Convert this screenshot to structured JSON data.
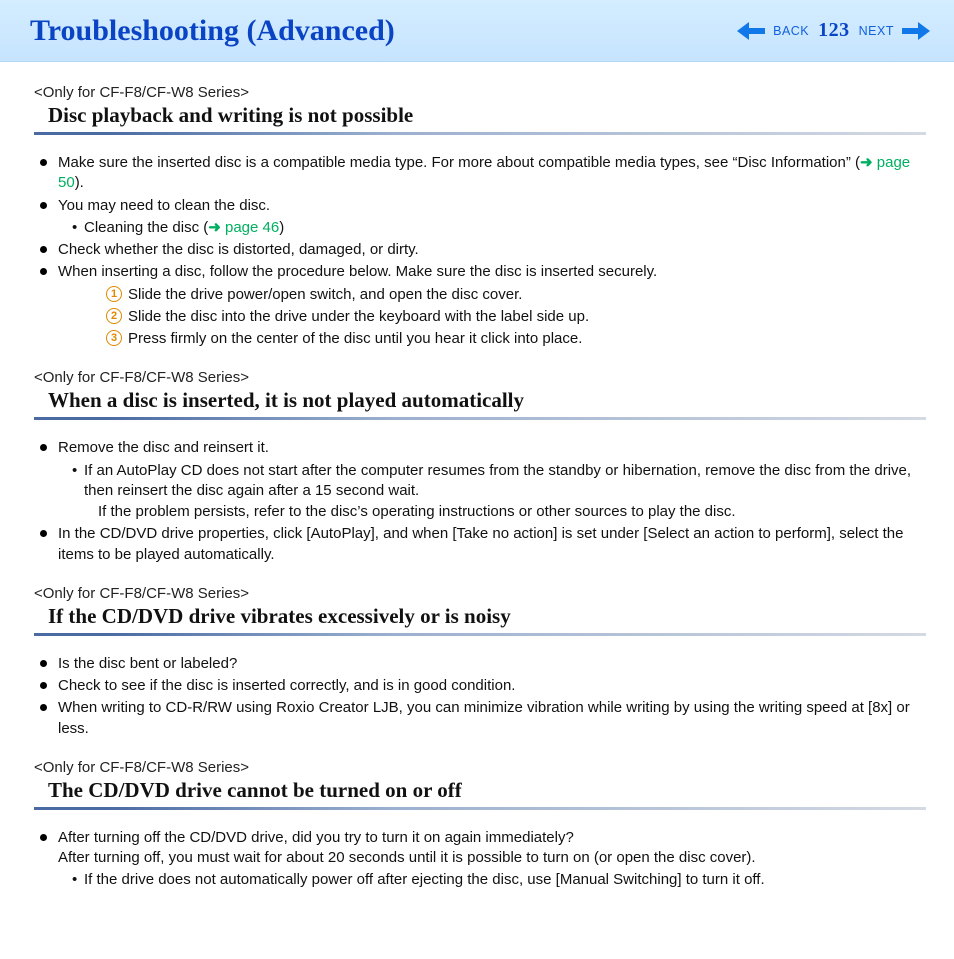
{
  "header": {
    "title": "Troubleshooting (Advanced)",
    "back": "BACK",
    "page": "123",
    "next": "NEXT"
  },
  "s1": {
    "tag": "<Only for CF-F8/CF-W8 Series>",
    "title": "Disc playback and writing is not possible",
    "b1a": "Make sure the inserted disc is a compatible media type. For more about compatible media types, see “Disc Information” (",
    "b1link": "page 50",
    "b1b": ").",
    "b2": "You may need to clean the disc.",
    "b2s_a": "Cleaning the disc (",
    "b2s_link": "page 46",
    "b2s_b": ")",
    "b3": "Check whether the disc is distorted, damaged, or dirty.",
    "b4": "When inserting a disc, follow the procedure below. Make sure the disc is inserted securely.",
    "step1": "Slide the drive power/open switch, and open the disc cover.",
    "step2": "Slide the disc into the drive under the keyboard with the label side up.",
    "step3": "Press firmly on the center of the disc until you hear it click into place."
  },
  "s2": {
    "tag": "<Only for CF-F8/CF-W8 Series>",
    "title": "When a disc is inserted, it is not played automatically",
    "b1": "Remove the disc and reinsert it.",
    "b1s1": "If an AutoPlay CD does not start after the computer resumes from the standby or hibernation, remove the disc from the drive, then reinsert the disc again after a 15 second wait.",
    "b1s2": "If the problem persists, refer to the disc’s operating instructions or other sources to play the disc.",
    "b2": "In the CD/DVD drive properties, click [AutoPlay], and when [Take no action] is set under [Select an action to perform], select the items to be played automatically."
  },
  "s3": {
    "tag": "<Only for CF-F8/CF-W8 Series>",
    "title": "If the CD/DVD drive vibrates excessively or is noisy",
    "b1": "Is the disc bent or labeled?",
    "b2": "Check to see if the disc is inserted correctly, and is in good condition.",
    "b3": "When writing to CD-R/RW using Roxio Creator LJB, you can minimize vibration while writing by using the writing speed at [8x] or less."
  },
  "s4": {
    "tag": "<Only for CF-F8/CF-W8 Series>",
    "title": "The CD/DVD drive cannot be turned on or off",
    "b1": "After turning off the CD/DVD drive, did you try to turn it on again immediately?",
    "b1c": "After turning off, you must wait for about 20 seconds until it is possible to turn on (or open the disc cover).",
    "b1s": "If the drive does not automatically power off after ejecting the disc, use [Manual Switching] to turn it off."
  }
}
